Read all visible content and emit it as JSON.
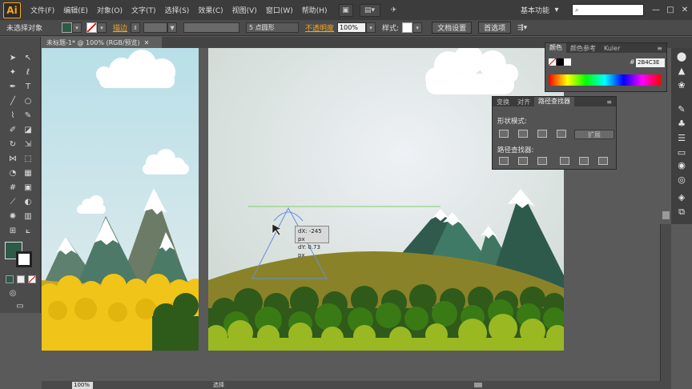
{
  "app": {
    "logo": "Ai",
    "menus": [
      "文件(F)",
      "编辑(E)",
      "对象(O)",
      "文字(T)",
      "选择(S)",
      "效果(C)",
      "视图(V)",
      "窗口(W)",
      "帮助(H)"
    ],
    "workspace": "基本功能",
    "search_placeholder": "",
    "window_controls": [
      "—",
      "□",
      "✕"
    ]
  },
  "control_bar": {
    "selection_status": "未选择对象",
    "stroke_label": "描边",
    "stroke_dropdown_arrow": "▼",
    "brush_label": "5 点圆形",
    "opacity_label": "不透明度",
    "opacity_value": "100%",
    "style_label": "样式:",
    "doc_setup_button": "文档设置",
    "preferences_button": "首选项"
  },
  "document_tab": {
    "title": "未标题-1* @ 100% (RGB/预览)",
    "close": "✕"
  },
  "color_panel": {
    "tabs": [
      "颜色",
      "颜色参考",
      "Kuler"
    ],
    "hex_value": "2B4C3E",
    "menu_icon": "≡"
  },
  "pathfinder_panel": {
    "tabs": [
      "变换",
      "对齐",
      "路径查找器"
    ],
    "shape_modes_label": "形状模式:",
    "expand_button": "扩展",
    "pathfinders_label": "路径查找器:"
  },
  "tooltip": {
    "dx": "dX: -245 px",
    "dy": "dY: 0.73 px"
  },
  "status_bar": {
    "zoom": "100%",
    "label": "选择"
  },
  "colors": {
    "fill": "#2e5a48",
    "stroke": "#ffffff",
    "accent_orange": "#f5a623",
    "dark_green": "#2f5a4c",
    "grass_yellow": "#8a8228",
    "bush_green": "#3a7a14",
    "bush_light": "#9ab822",
    "sun_yellow": "#f2c200"
  },
  "icons": {
    "tools": [
      "selection-tool-icon",
      "direct-selection-tool-icon",
      "magic-wand-icon",
      "lasso-icon",
      "pen-tool-icon",
      "type-tool-icon",
      "line-tool-icon",
      "rectangle-tool-icon",
      "paintbrush-icon",
      "pencil-icon",
      "blob-brush-icon",
      "eraser-icon",
      "rotate-icon",
      "scale-icon",
      "width-tool-icon",
      "free-transform-icon",
      "shape-builder-icon",
      "perspective-grid-icon",
      "mesh-icon",
      "gradient-icon",
      "eyedropper-icon",
      "blend-icon",
      "symbol-sprayer-icon",
      "column-graph-icon",
      "artboard-icon",
      "slice-icon",
      "hand-icon",
      "zoom-icon"
    ]
  }
}
